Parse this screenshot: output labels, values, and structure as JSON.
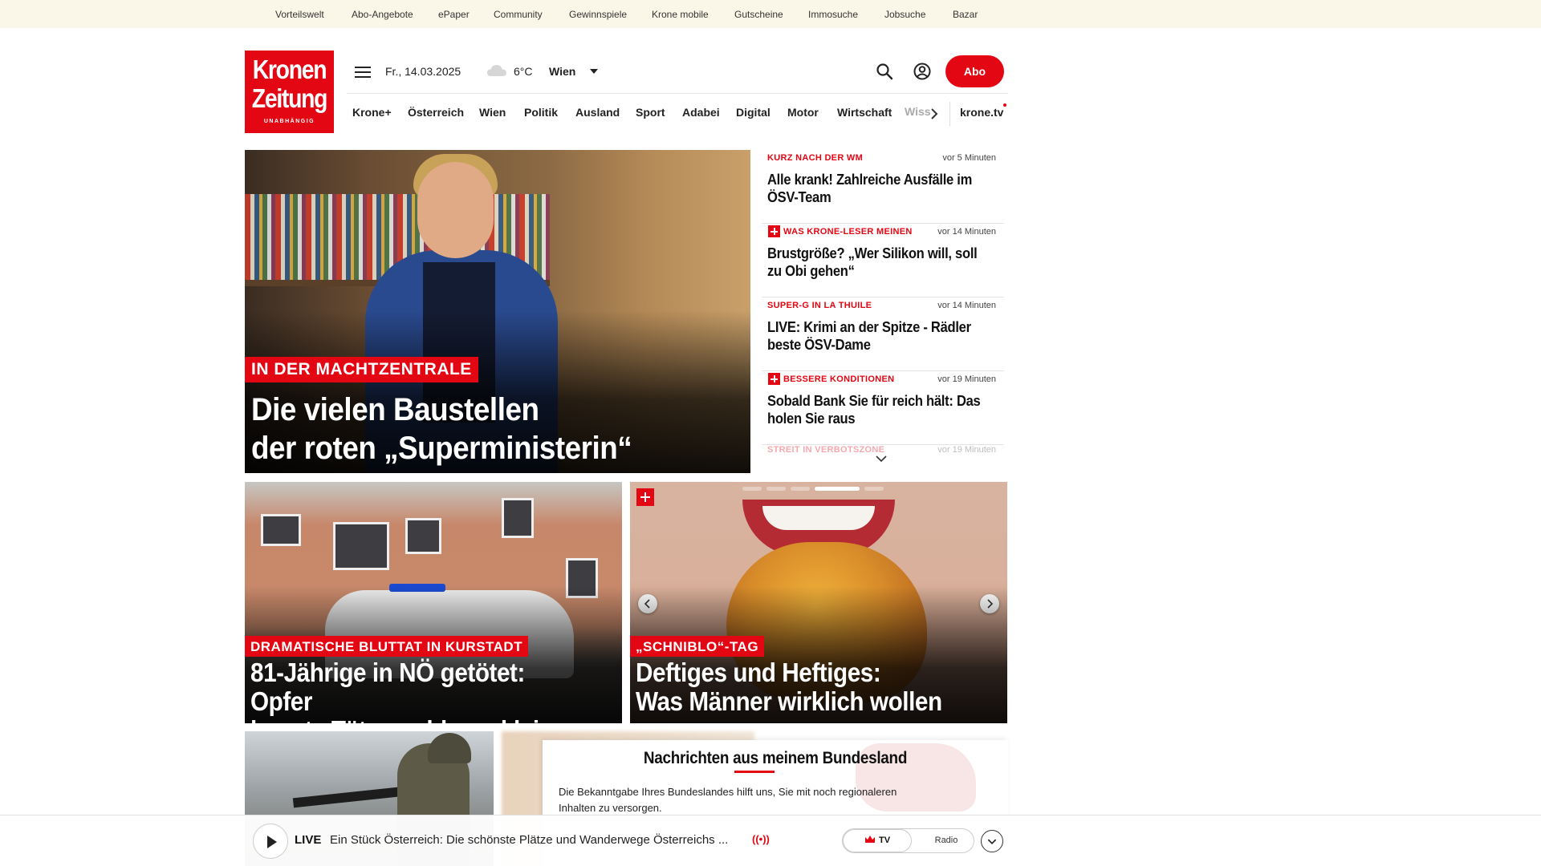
{
  "topbar": {
    "links": [
      "Vorteilswelt",
      "Abo-Angebote",
      "ePaper",
      "Community",
      "Gewinnspiele",
      "Krone mobile",
      "Gutscheine",
      "Immosuche",
      "Jobsuche",
      "Bazar"
    ]
  },
  "header": {
    "logo_line1": "Kronen",
    "logo_line2": "Zeitung",
    "logo_tagline": "UNABHÄNGIG",
    "date": "Fr., 14.03.2025",
    "weather_icon": "cloud-icon",
    "temperature": "6°C",
    "city": "Wien",
    "abo_label": "Abo"
  },
  "nav": {
    "items": [
      "Krone+",
      "Österreich",
      "Wien",
      "Politik",
      "Ausland",
      "Sport",
      "Adabei",
      "Digital",
      "Motor",
      "Wirtschaft"
    ],
    "overflow_item": "Wissenschaft",
    "tv_link": "krone.tv"
  },
  "hero": {
    "kicker": "IN DER MACHTZENTRALE",
    "headline_line1": "Die vielen Baustellen",
    "headline_line2": "der roten „Superministerin“"
  },
  "news_list": [
    {
      "kicker": "KURZ NACH DER WM",
      "time": "vor 5 Minuten",
      "title": "Alle krank! Zahlreiche Ausfälle im ÖSV-Team",
      "plus": false
    },
    {
      "kicker": "WAS KRONE-LESER MEINEN",
      "time": "vor 14 Minuten",
      "title": "Brustgröße? „Wer Silikon will, soll zu Obi gehen“",
      "plus": true
    },
    {
      "kicker": "SUPER-G IN LA THUILE",
      "time": "vor 14 Minuten",
      "title": "LIVE: Krimi an der Spitze - Rädler beste ÖSV-Dame",
      "plus": false
    },
    {
      "kicker": "BESSERE KONDITIONEN",
      "time": "vor 19 Minuten",
      "title": "Sobald Bank Sie für reich hält: Das holen Sie raus",
      "plus": true
    },
    {
      "kicker": "STREIT IN VERBOTSZONE",
      "time": "vor 19 Minuten"
    }
  ],
  "card1": {
    "kicker": "DRAMATISCHE BLUTTAT IN KURSTADT",
    "headline_line1": "81-Jährige in NÖ getötet: Opfer",
    "headline_line2": "kannte Täter wohl von klein auf"
  },
  "card2": {
    "kicker": "„SCHNIBLO“-TAG",
    "headline_line1": "Deftiges und Heftiges:",
    "headline_line2": "Was Männer wirklich wollen"
  },
  "bundesland": {
    "title": "Nachrichten aus meinem Bundesland",
    "text": "Die Bekanntgabe Ihres Bundeslandes hilft uns, Sie mit noch regionaleren Inhalten zu versorgen."
  },
  "player": {
    "live_label": "LIVE",
    "title": "Ein Stück Österreich: Die schönste Plätze und Wanderwege Österreichs ...",
    "cast_label": "((•))",
    "tv_label": "TV",
    "radio_label": "Radio"
  },
  "colors": {
    "brand_red": "#e30613",
    "topbar_bg": "#fbf7e8"
  }
}
